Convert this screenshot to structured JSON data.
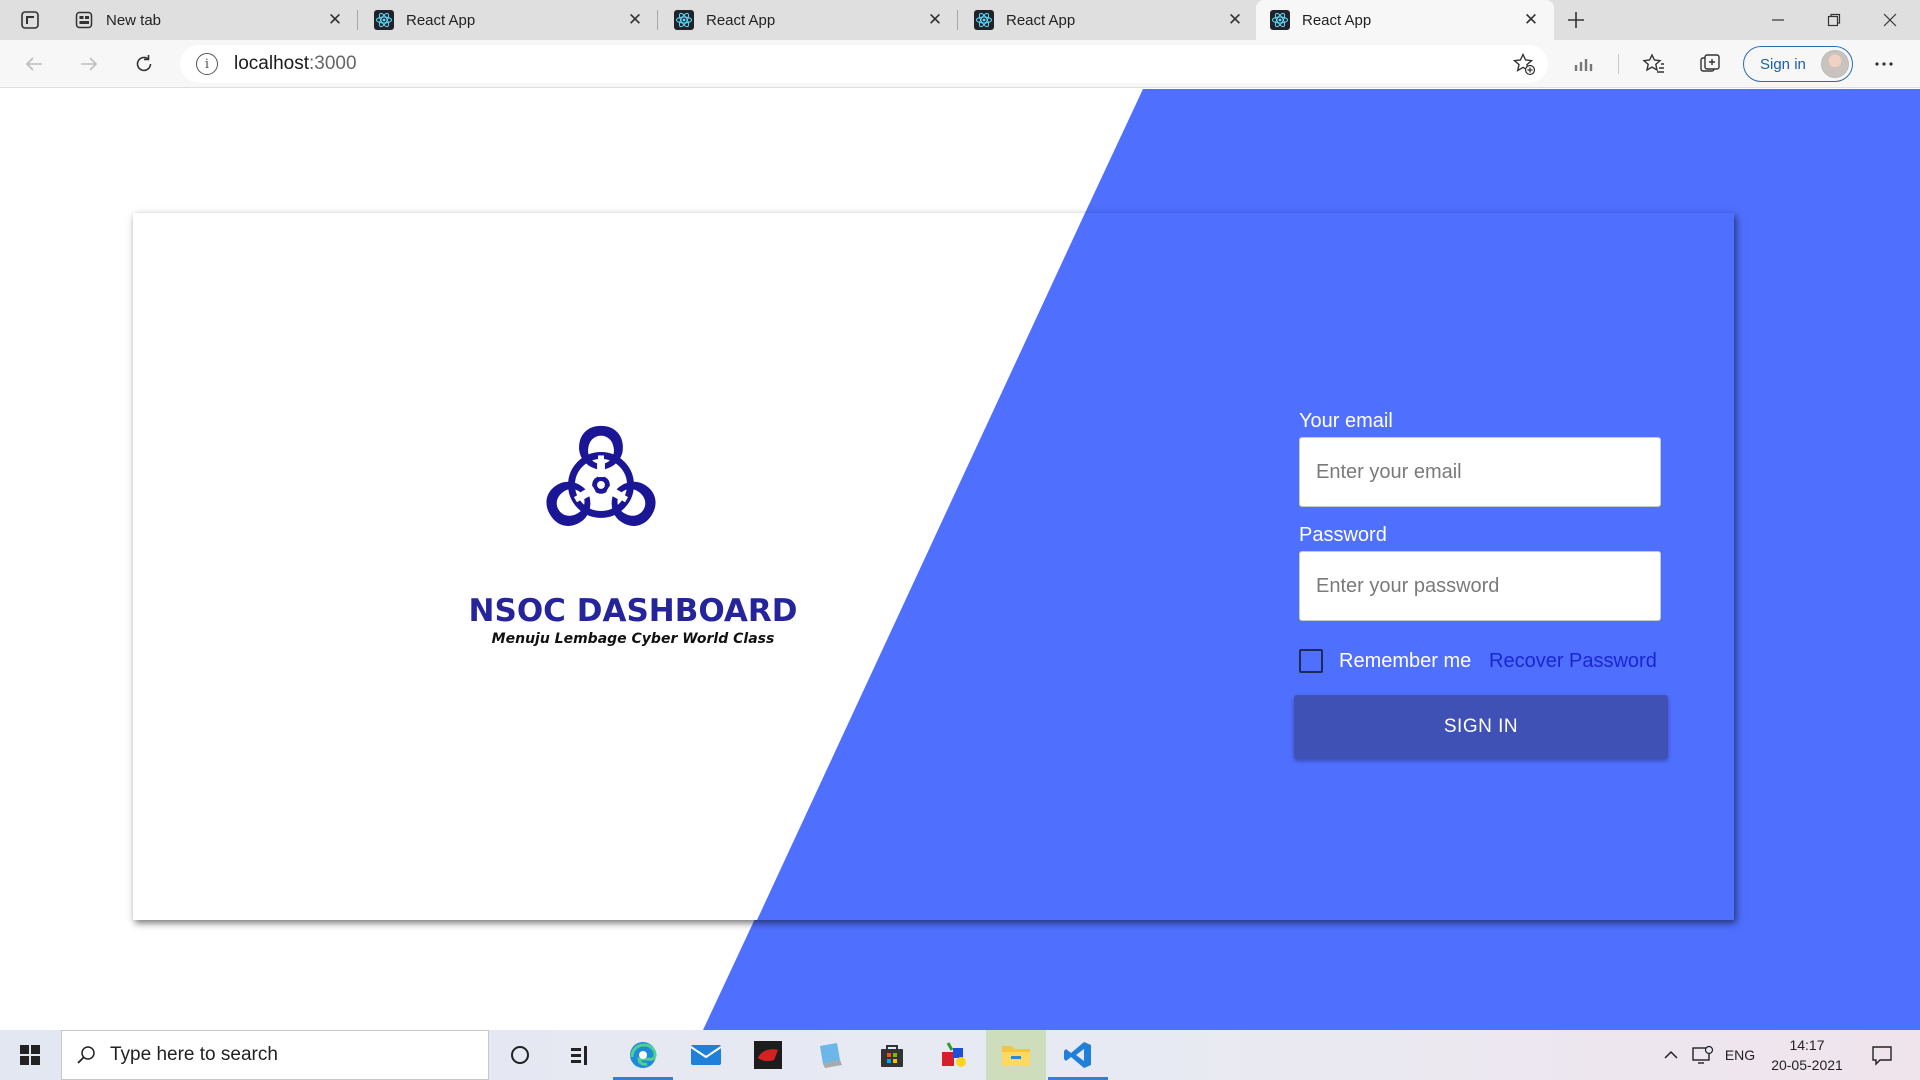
{
  "browser": {
    "tabs": [
      {
        "title": "New tab",
        "icon": "newtab-icon",
        "active": false
      },
      {
        "title": "React App",
        "icon": "react-icon",
        "active": false
      },
      {
        "title": "React App",
        "icon": "react-icon",
        "active": false
      },
      {
        "title": "React App",
        "icon": "react-icon",
        "active": false
      },
      {
        "title": "React App",
        "icon": "react-icon",
        "active": true
      }
    ],
    "url_host": "localhost",
    "url_port": ":3000",
    "signin_label": "Sign in"
  },
  "login": {
    "brand_title": "NSOC DASHBOARD",
    "brand_subtitle": "Menuju Lembage Cyber World Class",
    "email_label": "Your email",
    "email_placeholder": "Enter your email",
    "password_label": "Password",
    "password_placeholder": "Enter your password",
    "remember_label": "Remember me",
    "recover_label": "Recover Password",
    "signin_button": "SIGN IN"
  },
  "taskbar": {
    "search_placeholder": "Type here to search",
    "language": "ENG",
    "time": "14:17",
    "date": "20-05-2021"
  },
  "colors": {
    "accent_blue": "#4f6ffe",
    "button_blue": "#3f51b5",
    "brand_navy": "#25249a",
    "logo_navy": "#1a1696",
    "link_blue": "#1a25d6"
  }
}
